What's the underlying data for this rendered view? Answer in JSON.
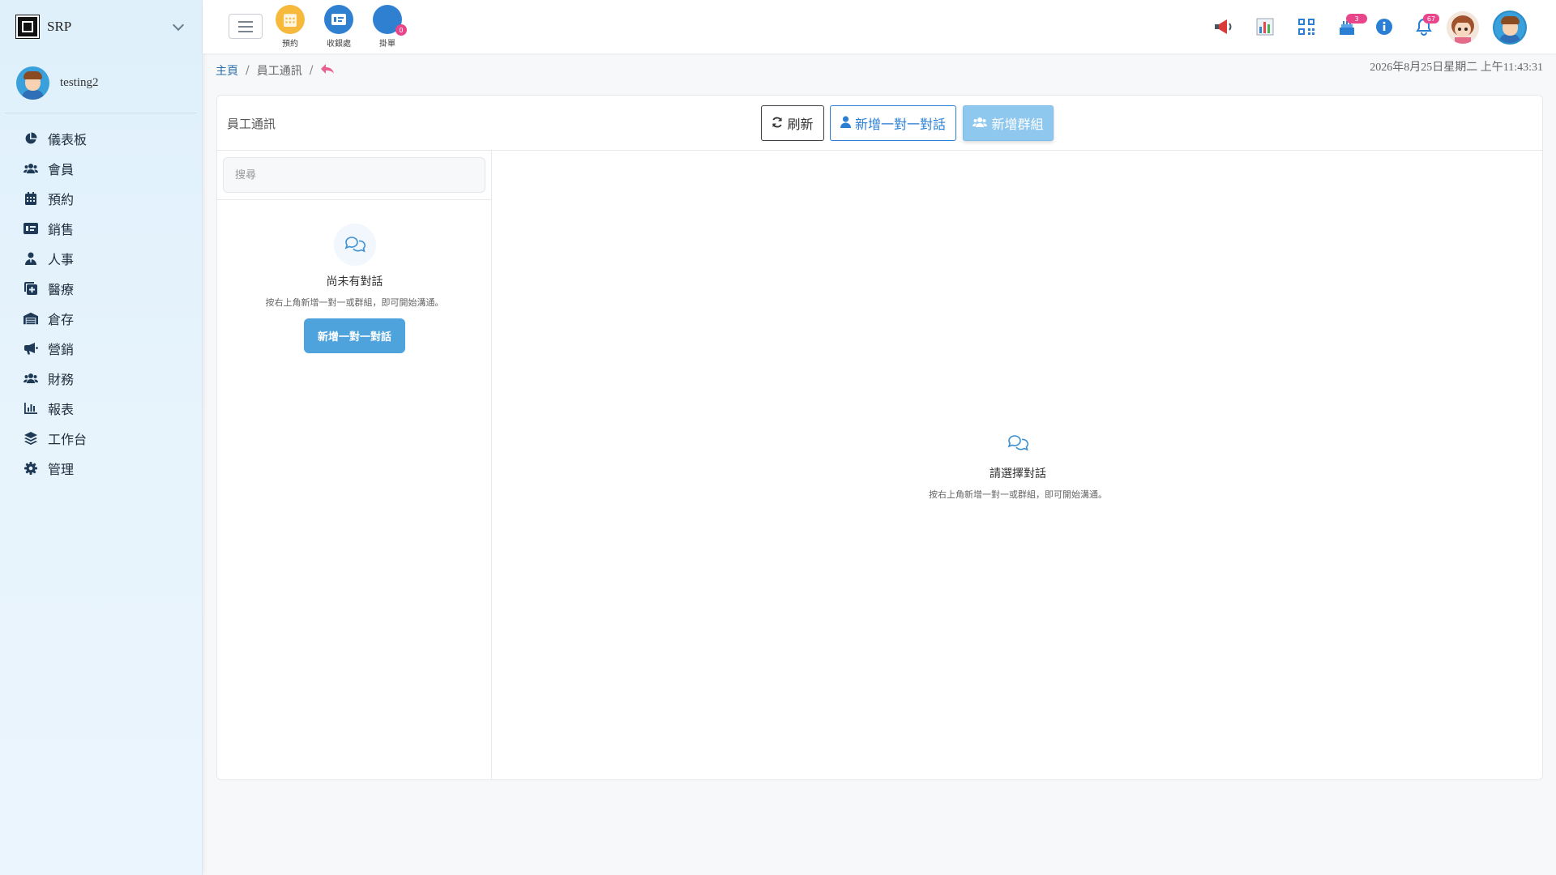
{
  "sidebar": {
    "brand": "SRP",
    "user_name": "testing2",
    "items": [
      {
        "label": "儀表板",
        "icon": "pie-chart-icon"
      },
      {
        "label": "會員",
        "icon": "users-icon"
      },
      {
        "label": "預約",
        "icon": "calendar-icon"
      },
      {
        "label": "銷售",
        "icon": "money-card-icon"
      },
      {
        "label": "人事",
        "icon": "user-tie-icon"
      },
      {
        "label": "醫療",
        "icon": "medical-icon"
      },
      {
        "label": "倉存",
        "icon": "warehouse-icon"
      },
      {
        "label": "營銷",
        "icon": "megaphone-icon"
      },
      {
        "label": "財務",
        "icon": "users-icon"
      },
      {
        "label": "報表",
        "icon": "bar-chart-icon"
      },
      {
        "label": "工作台",
        "icon": "layers-icon"
      },
      {
        "label": "管理",
        "icon": "gear-icon"
      }
    ]
  },
  "topbar": {
    "quick": [
      {
        "label": "預約",
        "icon": "calendar-icon",
        "color": "#f6b93b"
      },
      {
        "label": "收銀處",
        "icon": "money-card-icon",
        "color": "#2f80d1"
      },
      {
        "label": "掛單",
        "icon": "circle-icon",
        "color": "#2f80d1",
        "badge": "0"
      }
    ],
    "badges": {
      "cake": "3",
      "bell": "67"
    }
  },
  "breadcrumb": {
    "home": "主頁",
    "current": "員工通訊"
  },
  "datetime": "2026年8月25日星期二 上午11:43:31",
  "panel": {
    "title": "員工通訊",
    "refresh": "刷新",
    "new_one": "新增一對一對話",
    "new_group": "新增群組",
    "search_placeholder": "搜尋",
    "empty_left": {
      "title": "尚未有對話",
      "sub": "按右上角新增一對一或群組，即可開始溝通。",
      "button": "新增一對一對話"
    },
    "empty_right": {
      "title": "請選擇對話",
      "sub": "按右上角新增一對一或群組，即可開始溝通。"
    }
  },
  "colors": {
    "accent": "#2a7fd4",
    "badge": "#e8458b",
    "primary_button": "#4ea3dc"
  }
}
